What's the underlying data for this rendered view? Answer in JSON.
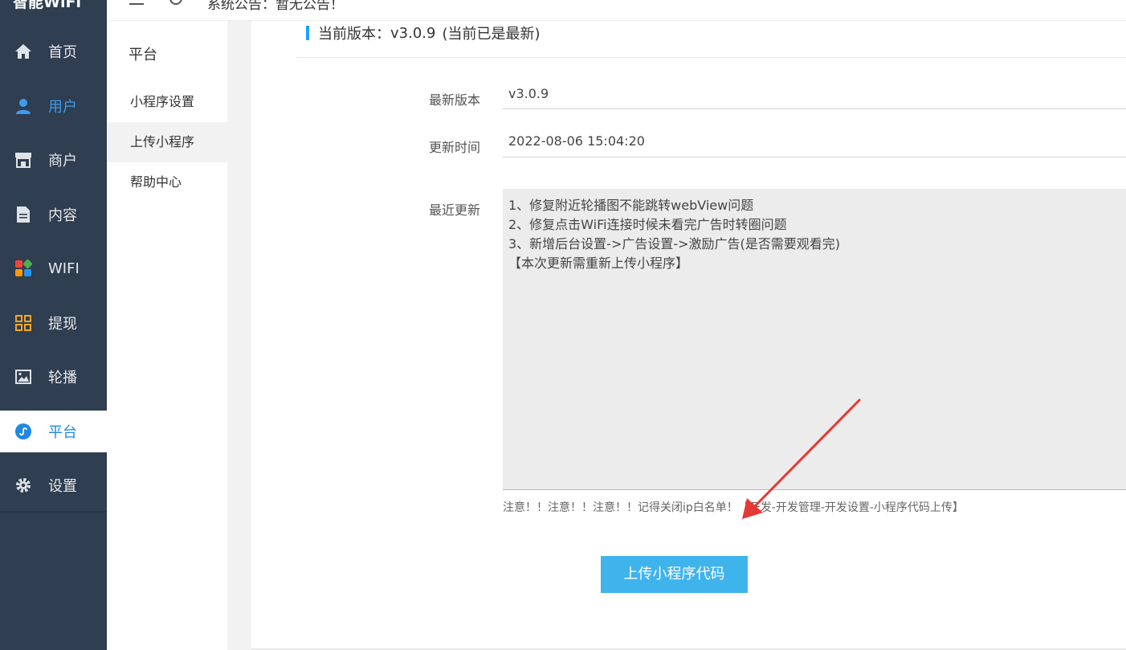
{
  "app": {
    "logo": "智能WiFi"
  },
  "sidebar": {
    "items": [
      {
        "label": "首页",
        "icon": "home-icon"
      },
      {
        "label": "用户",
        "icon": "user-icon"
      },
      {
        "label": "商户",
        "icon": "store-icon"
      },
      {
        "label": "内容",
        "icon": "document-icon"
      },
      {
        "label": "WIFI",
        "icon": "wifi-apps-icon"
      },
      {
        "label": "提现",
        "icon": "grid-icon"
      },
      {
        "label": "轮播",
        "icon": "image-icon"
      },
      {
        "label": "平台",
        "icon": "miniprogram-icon"
      },
      {
        "label": "设置",
        "icon": "gear-icon"
      }
    ],
    "active": "平台"
  },
  "topbar": {
    "notice": "系统公告：暂无公告！"
  },
  "subnav": {
    "title": "平台",
    "items": [
      {
        "label": "小程序设置"
      },
      {
        "label": "上传小程序"
      },
      {
        "label": "帮助中心"
      }
    ],
    "active": "上传小程序"
  },
  "main": {
    "current_version_label": "当前版本：",
    "current_version": "v3.0.9",
    "current_version_status": "(当前已是最新)",
    "latest_version_label": "最新版本",
    "latest_version": "v3.0.9",
    "update_time_label": "更新时间",
    "update_time": "2022-08-06 15:04:20",
    "recent_update_label": "最近更新",
    "changelog": [
      "1、修复附近轮播图不能跳转webView问题",
      "2、修复点击WiFi连接时候未看完广告时转圈问题",
      "3、新增后台设置->广告设置->激励广告(是否需要观看完)",
      "【本次更新需重新上传小程序】"
    ],
    "warning": "注意！！注意！！注意！！记得关闭ip白名单！【开发-开发管理-开发设置-小程序代码上传】",
    "upload_button": "上传小程序代码"
  },
  "colors": {
    "sidebar_bg": "#2f3e50",
    "accent": "#1e88e5",
    "button": "#3fb3ec",
    "arrow": "#e53935"
  }
}
